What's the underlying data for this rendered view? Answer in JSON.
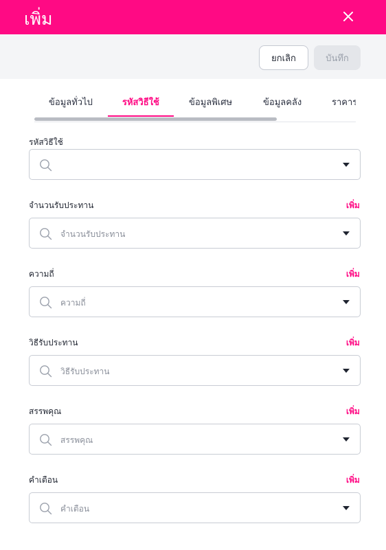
{
  "header": {
    "title": "เพิ่ม",
    "close_icon": "close-icon",
    "color": "#ff0a84"
  },
  "toolbar": {
    "cancel_label": "ยกเลิก",
    "save_label": "บันทึก"
  },
  "tabs": [
    {
      "label": "ข้อมูลทั่วไป",
      "active": false
    },
    {
      "label": "รหัสวิธีใช้",
      "active": true
    },
    {
      "label": "ข้อมูลพิเศษ",
      "active": false
    },
    {
      "label": "ข้อมูลคลัง",
      "active": false
    },
    {
      "label": "ราคาร",
      "active": false
    }
  ],
  "fields": [
    {
      "label": "รหัสวิธีใช้",
      "add_label": "",
      "placeholder": ""
    },
    {
      "label": "จำนวนรับประทาน",
      "add_label": "เพิ่ม",
      "placeholder": "จำนวนรับประทาน"
    },
    {
      "label": "ความถี่",
      "add_label": "เพิ่ม",
      "placeholder": "ความถี่"
    },
    {
      "label": "วิธีรับประทาน",
      "add_label": "เพิ่ม",
      "placeholder": "วิธีรับประทาน"
    },
    {
      "label": "สรรพคุณ",
      "add_label": "เพิ่ม",
      "placeholder": "สรรพคุณ"
    },
    {
      "label": "คำเตือน",
      "add_label": "เพิ่ม",
      "placeholder": "คำเตือน"
    }
  ],
  "icons": {
    "search": "search-icon",
    "dropdown": "caret-down-icon"
  },
  "colors": {
    "accent": "#ff0a84",
    "muted": "#8a8f9a"
  }
}
